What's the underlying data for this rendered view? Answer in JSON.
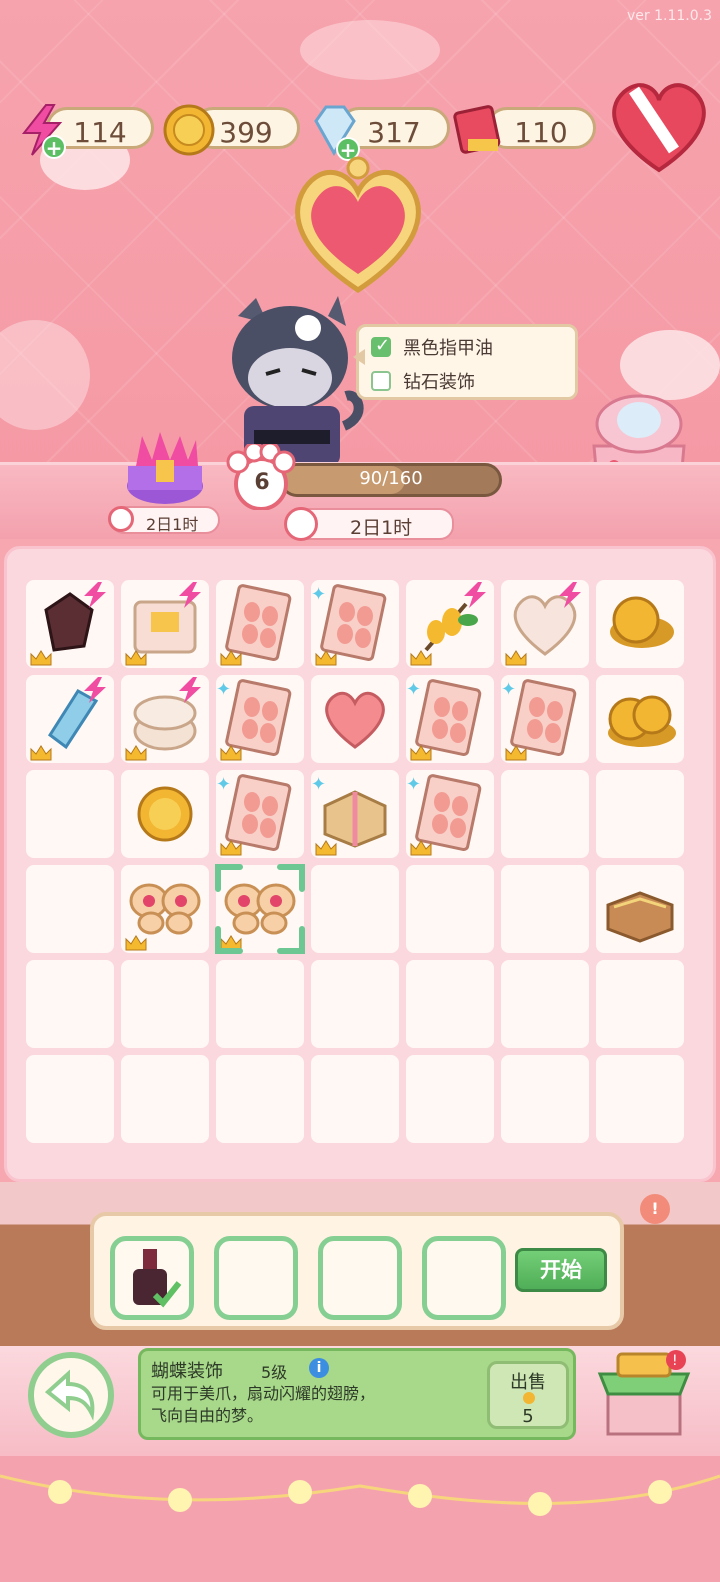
{
  "version": {
    "line1": "",
    "line2": "ver 1.11.0.3"
  },
  "resources": [
    {
      "name": "energy",
      "icon": "lightning-icon",
      "value": "114",
      "has_plus": true
    },
    {
      "name": "coins",
      "icon": "coin-icon",
      "value": "399",
      "has_plus": false
    },
    {
      "name": "diamonds",
      "icon": "diamond-icon",
      "value": "317",
      "has_plus": true
    },
    {
      "name": "tickets",
      "icon": "ticket-book-icon",
      "value": "110",
      "has_plus": false
    }
  ],
  "tasks": [
    {
      "label": "黑色指甲油",
      "done": true
    },
    {
      "label": "钻石装饰",
      "done": false
    }
  ],
  "level": {
    "number": "6",
    "progress_text": "90/160",
    "progress_fraction": 0.5625
  },
  "timers": {
    "chest": "2日1时",
    "main": "2日1时"
  },
  "board": {
    "columns": 7,
    "rows": 6,
    "cells": [
      {
        "r": 0,
        "c": 0,
        "item": "dark-crystal-icon",
        "energy": true,
        "crown": true
      },
      {
        "r": 0,
        "c": 1,
        "item": "pearl-box-icon",
        "energy": true,
        "crown": true
      },
      {
        "r": 0,
        "c": 2,
        "item": "nail-tips-icon",
        "energy": false,
        "crown": true
      },
      {
        "r": 0,
        "c": 3,
        "item": "nail-tips-icon",
        "energy": false,
        "crown": true,
        "sparkle": true
      },
      {
        "r": 0,
        "c": 4,
        "item": "lemon-branch-icon",
        "energy": true,
        "crown": true
      },
      {
        "r": 0,
        "c": 5,
        "item": "heart-box-icon",
        "energy": true,
        "crown": true
      },
      {
        "r": 0,
        "c": 6,
        "item": "coin-stack-icon",
        "energy": false,
        "crown": false
      },
      {
        "r": 1,
        "c": 0,
        "item": "blue-crystal-icon",
        "energy": true,
        "crown": true
      },
      {
        "r": 1,
        "c": 1,
        "item": "round-box-icon",
        "energy": true,
        "crown": true
      },
      {
        "r": 1,
        "c": 2,
        "item": "nail-tips-icon",
        "energy": false,
        "crown": true,
        "sparkle": true
      },
      {
        "r": 1,
        "c": 3,
        "item": "heart-chocolate-icon",
        "energy": false,
        "crown": false
      },
      {
        "r": 1,
        "c": 4,
        "item": "nail-tips-icon",
        "energy": false,
        "crown": true,
        "sparkle": true
      },
      {
        "r": 1,
        "c": 5,
        "item": "nail-tips-icon",
        "energy": false,
        "crown": true,
        "sparkle": true
      },
      {
        "r": 1,
        "c": 6,
        "item": "coin-pile-icon",
        "energy": false,
        "crown": false
      },
      {
        "r": 2,
        "c": 0,
        "item": "",
        "energy": false,
        "crown": false
      },
      {
        "r": 2,
        "c": 1,
        "item": "coin-icon",
        "energy": false,
        "crown": false
      },
      {
        "r": 2,
        "c": 2,
        "item": "nail-tips-icon",
        "energy": false,
        "crown": true,
        "sparkle": true
      },
      {
        "r": 2,
        "c": 3,
        "item": "gift-box-icon",
        "energy": false,
        "crown": true,
        "sparkle": true
      },
      {
        "r": 2,
        "c": 4,
        "item": "nail-tips-icon",
        "energy": false,
        "crown": true,
        "sparkle": true
      },
      {
        "r": 2,
        "c": 5,
        "item": "",
        "energy": false,
        "crown": false
      },
      {
        "r": 2,
        "c": 6,
        "item": "",
        "energy": false,
        "crown": false
      },
      {
        "r": 3,
        "c": 0,
        "item": "",
        "energy": false,
        "crown": false
      },
      {
        "r": 3,
        "c": 1,
        "item": "butterfly-icon",
        "energy": false,
        "crown": true
      },
      {
        "r": 3,
        "c": 2,
        "item": "butterfly-icon",
        "energy": false,
        "crown": true,
        "selected": true
      },
      {
        "r": 3,
        "c": 3,
        "item": "",
        "energy": false,
        "crown": false
      },
      {
        "r": 3,
        "c": 4,
        "item": "",
        "energy": false,
        "crown": false
      },
      {
        "r": 3,
        "c": 5,
        "item": "",
        "energy": false,
        "crown": false
      },
      {
        "r": 3,
        "c": 6,
        "item": "open-box-icon",
        "energy": false,
        "crown": false
      }
    ]
  },
  "tray": {
    "start_label": "开始",
    "slot_count": 4,
    "first_slot_icon": "nail-polish-icon"
  },
  "item_info": {
    "name": "蝴蝶装饰",
    "level": "5级",
    "description_line1": "可用于美爪，扇动闪耀的翅膀，",
    "description_line2": "飞向自由的梦。",
    "sell_label": "出售",
    "sell_price": "5"
  },
  "colors": {
    "accent_pink": "#f6a3ad",
    "green": "#76b85e",
    "brown": "#a47b5a"
  }
}
